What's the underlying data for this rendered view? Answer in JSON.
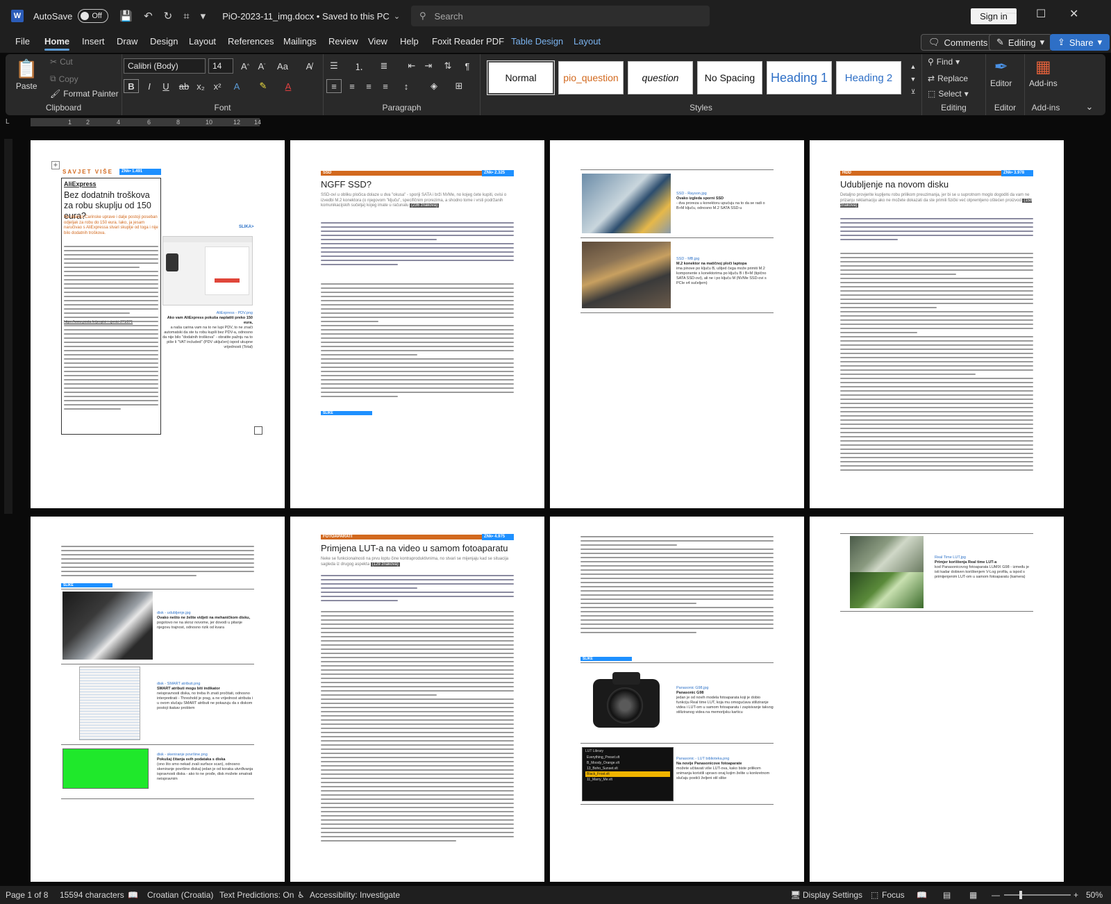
{
  "titlebar": {
    "autosave_label": "AutoSave",
    "autosave_state": "Off",
    "document_title": "PiO-2023-11_img.docx • Saved to this PC",
    "search_placeholder": "Search",
    "signin_label": "Sign in"
  },
  "menu": {
    "tabs": [
      "File",
      "Home",
      "Insert",
      "Draw",
      "Design",
      "Layout",
      "References",
      "Mailings",
      "Review",
      "View",
      "Help",
      "Foxit Reader PDF",
      "Table Design",
      "Layout"
    ],
    "active_tab": "Home",
    "comments_label": "Comments",
    "editing_label": "Editing",
    "share_label": "Share"
  },
  "ribbon": {
    "clipboard": {
      "paste": "Paste",
      "cut": "Cut",
      "copy": "Copy",
      "format_painter": "Format Painter",
      "label": "Clipboard"
    },
    "font": {
      "font_name": "Calibri (Body)",
      "font_size": "14",
      "label": "Font"
    },
    "paragraph": {
      "label": "Paragraph"
    },
    "styles": {
      "items": [
        "Normal",
        "pio_question",
        "question",
        "No Spacing",
        "Heading 1",
        "Heading 2"
      ],
      "label": "Styles"
    },
    "editing": {
      "find": "Find",
      "replace": "Replace",
      "select": "Select",
      "label": "Editing"
    },
    "editor": {
      "button": "Editor",
      "label": "Editor"
    },
    "addins": {
      "button": "Add-ins",
      "label": "Add-ins"
    }
  },
  "ruler": {
    "ticks": [
      "1",
      "2",
      "4",
      "6",
      "8",
      "10",
      "12",
      "14"
    ]
  },
  "pages": {
    "p1": {
      "section": "SAVJET VIŠE",
      "znk": "ZNk• 1.491",
      "brand": "AliExpress",
      "title": "Bez dodatnih troškova za robu skuplju od 150 eura?",
      "lead": "Na stranici Carinske uprave i dalje postoji poseban odjeljak za robu do 150 eura. Iako, ja jesam naručivao s AliExpressa stvari skuplje od toga i nije bilo dodatnih troškova.",
      "slika": "SLIKA>",
      "caption_file": "AliExpress - PDV.png",
      "caption_bold": "Ako vam AliExpress pokuša naplatiti preko 150 eura,",
      "caption_text": "a naša carina vam na to ne lupi PDV, to ne znači automatski da ste tu robu kupili bez PDV-a, odnosno da nije bilo \"dodatnih troškova\" - obratite pažnju na to piše li \"VAT included\" (PDV uključen) ispod ukupne vrijednosti (Total)",
      "link": "https://www.posta.hr/propisi-i-cjenici-271/271"
    },
    "p2": {
      "section": "SSD",
      "znk": "ZNk• 2.325",
      "title": "NGFF SSD?",
      "lead": "SSD-ovi u obliku pločica dolaze u dva \"okusa\" - sporiji SATA i brži NVMe, no kojeg ćete kupiti, ovisi o izvedbi M.2 konektora (o njegovom \"ključu\", specifičnim prorezima, a shodno tome i vrsti podržanih komunikacijskih sučelja) kojeg imate u računalu",
      "count": "(236 znakova)",
      "slika": "SLIKE"
    },
    "p3": {
      "cap1_file": "SSD - Rayson.jpg",
      "cap1_bold": "Ovako izgleda sporni SSD",
      "cap1_text": "- dva proreza u konektoru upućuju na to da se radi o B+M ključu, odnosno M.2 SATA SSD-u",
      "cap2_file": "SSD - MB.jpg",
      "cap2_bold": "M.2 konektor na matičnoj ploči laptopa",
      "cap2_text": "ima pinove po ključu B, ušljed čega može primiti M.2 komponente s konektorima po ključu B i B+M (tipično SATA SSD-ovi), ali ne i po ključu M (NVMe SSD-ovi s PCIe x4 sučeljem)"
    },
    "p4": {
      "section": "HDD",
      "znk": "ZNk• 3.978",
      "title": "Udubljenje na novom disku",
      "lead": "Detaljno provjerite kupljenu robu prilikom preuzimanja, jer bi se u suprotnom moglo dogoditi da vam ne prizanju reklamaciju ako ne možete dokazati da ste primili fizički već otpremljeno oštećen proizvod",
      "count": "(158 znakova)"
    },
    "p5": {
      "slika": "SLIKE",
      "cap1_file": "disk - udubljenje.jpg",
      "cap1_bold": "Ovako nešto ne želite vidjeti na mehaničkom disku,",
      "cap1_text": "pogotovo ne na skroz novome, jer dovodi u pitanje njegovu trajnost, odnosno rizik od kvara",
      "cap2_file": "disk - SMART atributi.png",
      "cap2_bold": "SMART atributi mogu biti indikator",
      "cap2_text": "neispravnosti diska, no treba ih znati pročitati, odnosno interpretirati - Threshold je prag, a ne vrijednost atributa i u ovom slučaju SMART atributi ne pokazuju da s diskom postoji ikakav problem",
      "cap3_file": "disk - skeniranje površine.png",
      "cap3_bold": "Pokušaj čitanja svih podataka s diska",
      "cap3_text": "(ono što smo nekad zvali surface scan), odnosno skeniranje površine diska) jedan je od koraka utvrđivanja ispravnosti diska - ako to ne prođe, disk možete smatrati neispravnim"
    },
    "p6": {
      "section": "FOTOAPARATI",
      "znk": "ZNk• 4.975",
      "title": "Primjena LUT-a na video u samom fotoaparatu",
      "lead": "Neke se funkcionalnosti na prvu loptu čine kontraproduktivnima, no stvari se mijenjaju kad se situacija sagleda iz drugog aspekta",
      "count": "(129 znakova)"
    },
    "p7": {
      "slika": "SLIKE",
      "cap1_file": "Panasonic G98.jpg",
      "cap1_bold": "Panasonic G98",
      "cap1_text": "jedan je od novih modela fotoaparata koji je dobio funkciju Real time LUT, koja mu omogućava stiliziranje videa i LUT-om u samom fotoaparatu i zapisivanje takvog stiliziranog videa na memorijsku karticu",
      "cap2_file": "Panasonic - LUT biblioteka.png",
      "cap2_bold": "Na novije Panasonicove fotoaparate",
      "cap2_text": "možete učitavati više LUT-ova, kako biste prilikom snimanja koristili upravo onaj kojim želite u konkretnom slučaju postići željeni stil slike",
      "lut_title": "LUT Library",
      "lut_items": [
        "Everything_Preset.vlt",
        "B_Moody_Orange.vlt",
        "13_Boho_Sunset.vlt",
        "Black_Frost.vlt",
        "11_Marry_Me.vlt"
      ]
    },
    "p8": {
      "cap_file": "Real Time LUT.jpg",
      "cap_bold": "Primjer korištenja Real time LUT-a",
      "cap_text": "kod Panasonicovog fotoaparata LUMIX G98 - između je isti kadar dobiven korištenjem V-Log profila, a ispod s primijenjenim LUT-om u samom fotoaparatu (kamera)"
    }
  },
  "status": {
    "page": "Page 1 of 8",
    "characters": "15594 characters",
    "language": "Croatian (Croatia)",
    "predictions": "Text Predictions: On",
    "accessibility": "Accessibility: Investigate",
    "display_settings": "Display Settings",
    "focus": "Focus",
    "zoom": "50%"
  }
}
